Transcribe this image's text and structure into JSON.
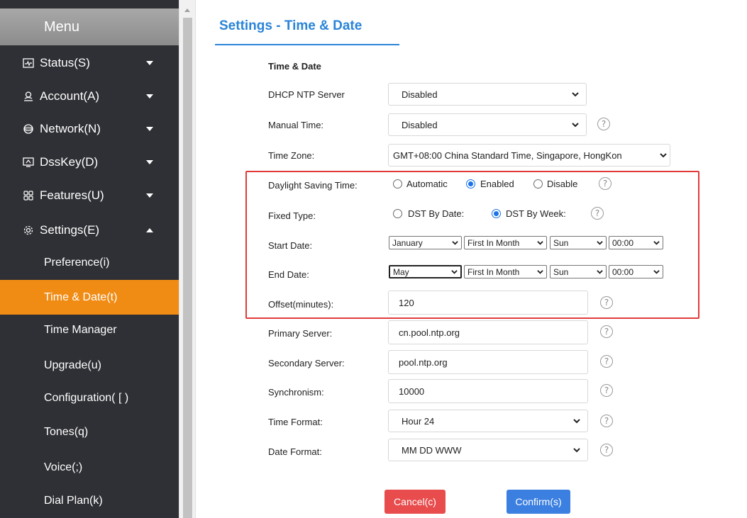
{
  "sidebar": {
    "header": "Menu",
    "nav": [
      {
        "label": "Status(S)",
        "icon": "status-icon"
      },
      {
        "label": "Account(A)",
        "icon": "account-icon"
      },
      {
        "label": "Network(N)",
        "icon": "network-icon"
      },
      {
        "label": "DssKey(D)",
        "icon": "dsskey-icon"
      },
      {
        "label": "Features(U)",
        "icon": "features-icon"
      },
      {
        "label": "Settings(E)",
        "icon": "settings-icon"
      }
    ],
    "sub": [
      "Preference(i)",
      "Time & Date(t)",
      "Time Manager",
      "Upgrade(u)",
      "Configuration( [ )",
      "Tones(q)",
      "Voice(;)",
      "Dial Plan(k)"
    ],
    "active_sub": "Time & Date(t)"
  },
  "page": {
    "title": "Settings - Time & Date",
    "section": "Time & Date"
  },
  "form": {
    "dhcp_ntp": {
      "label": "DHCP NTP Server",
      "value": "Disabled"
    },
    "manual_time": {
      "label": "Manual Time:",
      "value": "Disabled"
    },
    "time_zone": {
      "label": "Time Zone:",
      "value": "GMT+08:00 China Standard Time, Singapore, HongKon"
    },
    "dst": {
      "label": "Daylight Saving Time:",
      "options": [
        "Automatic",
        "Enabled",
        "Disable"
      ],
      "selected": "Enabled"
    },
    "fixed_type": {
      "label": "Fixed Type:",
      "options": [
        "DST By Date:",
        "DST By Week:"
      ],
      "selected": "DST By Week:"
    },
    "start_date": {
      "label": "Start Date:",
      "month": "January",
      "week": "First In Month",
      "day": "Sun",
      "time": "00:00"
    },
    "end_date": {
      "label": "End Date:",
      "month": "May",
      "week": "First In Month",
      "day": "Sun",
      "time": "00:00"
    },
    "offset": {
      "label": "Offset(minutes):",
      "value": "120"
    },
    "primary_server": {
      "label": "Primary Server:",
      "value": "cn.pool.ntp.org"
    },
    "secondary_server": {
      "label": "Secondary Server:",
      "value": "pool.ntp.org"
    },
    "synchronism": {
      "label": "Synchronism:",
      "value": "10000"
    },
    "time_format": {
      "label": "Time Format:",
      "value": "Hour 24"
    },
    "date_format": {
      "label": "Date Format:",
      "value": "MM DD WWW"
    }
  },
  "buttons": {
    "cancel": "Cancel(c)",
    "confirm": "Confirm(s)"
  },
  "help_glyph": "?",
  "colors": {
    "sidebar_bg": "#2f3035",
    "active": "#f08b14",
    "accent": "#2a84d8",
    "highlight": "#e23a3a",
    "cancel": "#e84c4c",
    "confirm": "#3b7fe0"
  }
}
